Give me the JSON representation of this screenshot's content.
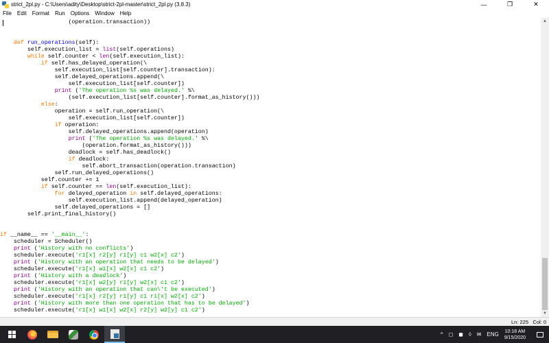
{
  "window": {
    "title": "strict_2pl.py - C:\\Users\\adity\\Desktop\\strict-2pl-master\\strict_2pl.py (3.8.3)",
    "controls": {
      "minimize": "—",
      "maximize": "❐",
      "close": "✕"
    }
  },
  "menu": [
    "File",
    "Edit",
    "Format",
    "Run",
    "Options",
    "Window",
    "Help"
  ],
  "editor": {
    "lines": [
      [
        [
          "",
          "                    (operation.transaction))"
        ]
      ],
      [
        [
          "",
          ""
        ]
      ],
      [
        [
          "",
          ""
        ]
      ],
      [
        [
          "",
          "    "
        ],
        [
          "kw",
          "def "
        ],
        [
          "fn",
          "run_operations"
        ],
        [
          "",
          "(self):"
        ]
      ],
      [
        [
          "",
          "        self.execution_list = "
        ],
        [
          "bi",
          "list"
        ],
        [
          "",
          "(self.operations)"
        ]
      ],
      [
        [
          "",
          "        "
        ],
        [
          "kw",
          "while"
        ],
        [
          "",
          " self.counter < "
        ],
        [
          "bi",
          "len"
        ],
        [
          "",
          "(self.execution_list):"
        ]
      ],
      [
        [
          "",
          "            "
        ],
        [
          "kw",
          "if"
        ],
        [
          "",
          " self.has_delayed_operation(\\"
        ]
      ],
      [
        [
          "",
          "                self.execution_list[self.counter].transaction):"
        ]
      ],
      [
        [
          "",
          "                self.delayed_operations.append(\\"
        ]
      ],
      [
        [
          "",
          "                    self.execution_list[self.counter])"
        ]
      ],
      [
        [
          "",
          "                "
        ],
        [
          "bi",
          "print"
        ],
        [
          "",
          " ("
        ],
        [
          "st",
          "'The operation %s was delayed.'"
        ],
        [
          "",
          " %\\"
        ]
      ],
      [
        [
          "",
          "                    (self.execution_list[self.counter].format_as_history()))"
        ]
      ],
      [
        [
          "",
          "            "
        ],
        [
          "kw",
          "else"
        ],
        [
          "",
          ":"
        ]
      ],
      [
        [
          "",
          "                operation = self.run_operation(\\"
        ]
      ],
      [
        [
          "",
          "                    self.execution_list[self.counter])"
        ]
      ],
      [
        [
          "",
          "                "
        ],
        [
          "kw",
          "if"
        ],
        [
          "",
          " operation:"
        ]
      ],
      [
        [
          "",
          "                    self.delayed_operations.append(operation)"
        ]
      ],
      [
        [
          "",
          "                    "
        ],
        [
          "bi",
          "print"
        ],
        [
          "",
          " ("
        ],
        [
          "st",
          "'The operation %s was delayed.'"
        ],
        [
          "",
          " %\\"
        ]
      ],
      [
        [
          "",
          "                        (operation.format_as_history()))"
        ]
      ],
      [
        [
          "",
          "                    deadlock = self.has_deadlock()"
        ]
      ],
      [
        [
          "",
          "                    "
        ],
        [
          "kw",
          "if"
        ],
        [
          "",
          " deadlock:"
        ]
      ],
      [
        [
          "",
          "                        self.abort_transaction(operation.transaction)"
        ]
      ],
      [
        [
          "",
          "                self.run_delayed_operations()"
        ]
      ],
      [
        [
          "",
          "            self.counter += 1"
        ]
      ],
      [
        [
          "",
          "            "
        ],
        [
          "kw",
          "if"
        ],
        [
          "",
          " self.counter == "
        ],
        [
          "bi",
          "len"
        ],
        [
          "",
          "(self.execution_list):"
        ]
      ],
      [
        [
          "",
          "                "
        ],
        [
          "kw",
          "for"
        ],
        [
          "",
          " delayed_operation "
        ],
        [
          "kw",
          "in"
        ],
        [
          "",
          " self.delayed_operations:"
        ]
      ],
      [
        [
          "",
          "                    self.execution_list.append(delayed_operation)"
        ]
      ],
      [
        [
          "",
          "                self.delayed_operations = []"
        ]
      ],
      [
        [
          "",
          "        self.print_final_history()"
        ]
      ],
      [
        [
          "",
          ""
        ]
      ],
      [
        [
          "",
          ""
        ]
      ],
      [
        [
          "kw",
          "if"
        ],
        [
          "",
          " __name__ == "
        ],
        [
          "st",
          "'__main__'"
        ],
        [
          "",
          ":"
        ]
      ],
      [
        [
          "",
          "    scheduler = Scheduler()"
        ]
      ],
      [
        [
          "",
          "    "
        ],
        [
          "bi",
          "print"
        ],
        [
          "",
          " ("
        ],
        [
          "st",
          "'History with no conflicts'"
        ],
        [
          "",
          ")"
        ]
      ],
      [
        [
          "",
          "    scheduler.execute("
        ],
        [
          "st",
          "'r1[x] r2[y] r1[y] c1 w2[x] c2'"
        ],
        [
          "",
          ")"
        ]
      ],
      [
        [
          "",
          "    "
        ],
        [
          "bi",
          "print"
        ],
        [
          "",
          " ("
        ],
        [
          "st",
          "'History with an operation that needs to be delayed'"
        ],
        [
          "",
          ")"
        ]
      ],
      [
        [
          "",
          "    scheduler.execute("
        ],
        [
          "st",
          "'r1[x] w1[x] w2[x] c1 c2'"
        ],
        [
          "",
          ")"
        ]
      ],
      [
        [
          "",
          "    "
        ],
        [
          "bi",
          "print"
        ],
        [
          "",
          " ("
        ],
        [
          "st",
          "'History with a deadlock'"
        ],
        [
          "",
          ")"
        ]
      ],
      [
        [
          "",
          "    scheduler.execute("
        ],
        [
          "st",
          "'r1[x] w2[y] r1[y] w2[x] c1 c2'"
        ],
        [
          "",
          ")"
        ]
      ],
      [
        [
          "",
          "    "
        ],
        [
          "bi",
          "print"
        ],
        [
          "",
          " ("
        ],
        [
          "st",
          "'History with an operation that can\\'t be executed'"
        ],
        [
          "",
          ")"
        ]
      ],
      [
        [
          "",
          "    scheduler.execute("
        ],
        [
          "st",
          "'r1[x] r2[y] r1[y] c1 r1[x] w2[x] c2'"
        ],
        [
          "",
          ")"
        ]
      ],
      [
        [
          "",
          "    "
        ],
        [
          "bi",
          "print"
        ],
        [
          "",
          " ("
        ],
        [
          "st",
          "'History with more than one operation that has to be delayed'"
        ],
        [
          "",
          ")"
        ]
      ],
      [
        [
          "",
          "    scheduler.execute("
        ],
        [
          "st",
          "'r1[x] w1[x] w2[x] r2[y] w2[y] c1 c2'"
        ],
        [
          "",
          ")"
        ]
      ]
    ]
  },
  "status": {
    "line": "Ln: 225",
    "col": "Col: 0"
  },
  "taskbar": {
    "apps": [
      "start",
      "firefox",
      "file-explorer",
      "app",
      "chrome",
      "idle-python"
    ],
    "tray_icons": [
      "^",
      "◻",
      "◼",
      "◊",
      "✉",
      "ENG"
    ],
    "time": "10:18 AM",
    "date": "9/15/2020"
  },
  "colors": {
    "keyword": "#ff7700",
    "function_name": "#0000ff",
    "builtin": "#900090",
    "string": "#00aa00",
    "taskbar_bg": "#1f1f24"
  }
}
